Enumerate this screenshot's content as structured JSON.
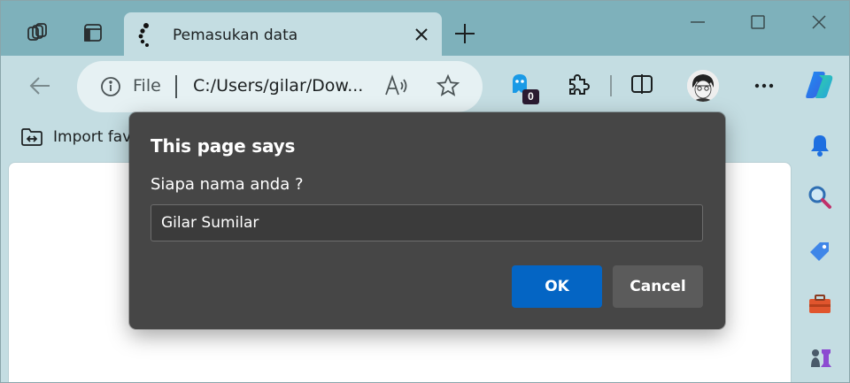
{
  "tab": {
    "title": "Pemasukan data",
    "favicon": "loading-spinner-icon"
  },
  "address_bar": {
    "scheme_label": "File",
    "url": "C:/Users/gilar/Dow..."
  },
  "extensions": {
    "ghostery_count": "0"
  },
  "favorites_bar": {
    "import_label": "Import favo"
  },
  "dialog": {
    "title": "This page says",
    "message": "Siapa nama anda ?",
    "input_value": "Gilar Sumilar",
    "ok_label": "OK",
    "cancel_label": "Cancel"
  },
  "colors": {
    "accent_button": "#0465c4",
    "dialog_background": "#464646",
    "toolbar_background": "#c4dde2",
    "tabstrip_background": "#7eb1bb"
  },
  "sidebar": {
    "items": [
      "notifications-bell-icon",
      "search-icon",
      "shopping-tag-icon",
      "tools-briefcase-icon",
      "games-chess-icon"
    ]
  }
}
